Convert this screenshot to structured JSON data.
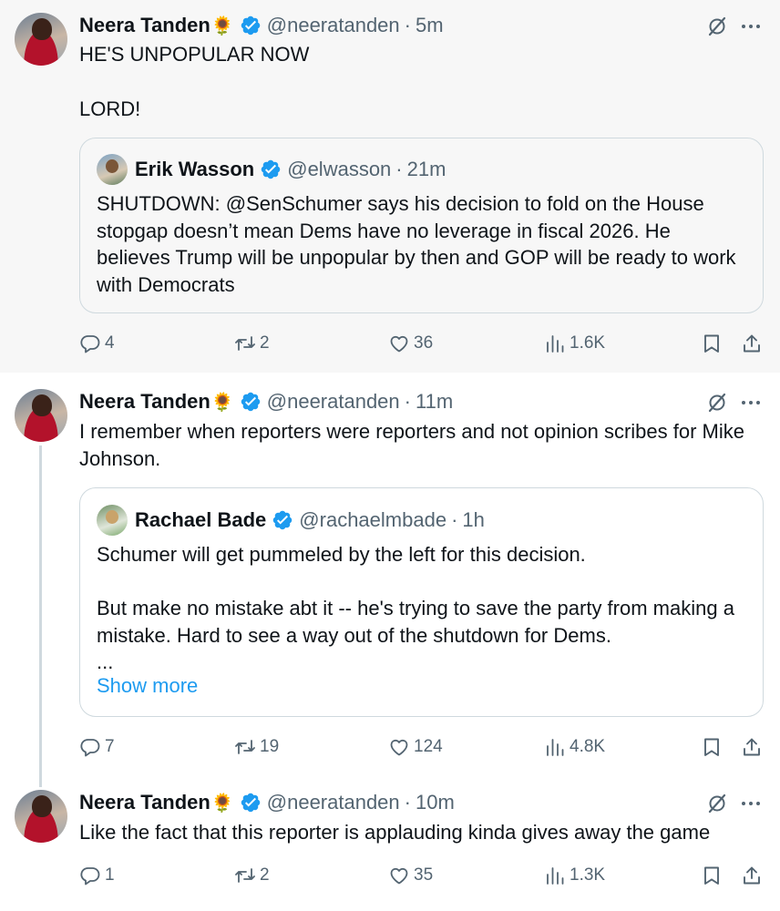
{
  "tweets": [
    {
      "author_name": "Neera Tanden",
      "emoji": "🌻",
      "handle": "@neeratanden",
      "dot": "·",
      "time": "5m",
      "text": "HE'S UNPOPULAR NOW\n\nLORD!",
      "quote": {
        "author_name": "Erik Wasson",
        "handle": "@elwasson",
        "dot": "·",
        "time": "21m",
        "text": "SHUTDOWN: @SenSchumer says his decision to fold on the House stopgap doesn’t mean Dems have no leverage in fiscal 2026. He believes Trump will be unpopular by then and GOP will be ready to work with Democrats"
      },
      "stats": {
        "replies": "4",
        "retweets": "2",
        "likes": "36",
        "views": "1.6K"
      }
    },
    {
      "author_name": "Neera Tanden",
      "emoji": "🌻",
      "handle": "@neeratanden",
      "dot": "·",
      "time": "11m",
      "text": "I remember when reporters were reporters and not opinion scribes for Mike Johnson.",
      "quote": {
        "author_name": "Rachael Bade",
        "handle": "@rachaelmbade",
        "dot": "·",
        "time": "1h",
        "text": "Schumer will get pummeled by the left for this decision.\n\nBut make no mistake abt it -- he's trying to save the party from making a mistake. Hard to see a way out of the shutdown for Dems.\n...",
        "show_more": "Show more"
      },
      "stats": {
        "replies": "7",
        "retweets": "19",
        "likes": "124",
        "views": "4.8K"
      }
    },
    {
      "author_name": "Neera Tanden",
      "emoji": "🌻",
      "handle": "@neeratanden",
      "dot": "·",
      "time": "10m",
      "text": "Like the fact that this reporter is applauding kinda gives away the game",
      "stats": {
        "replies": "1",
        "retweets": "2",
        "likes": "35",
        "views": "1.3K"
      }
    }
  ],
  "colors": {
    "accent": "#1d9bf0",
    "secondary_text": "#536471",
    "border": "#cfd9de"
  },
  "icons": [
    "verified-badge-icon",
    "grok-icon",
    "more-icon",
    "reply-icon",
    "retweet-icon",
    "like-icon",
    "views-icon",
    "bookmark-icon",
    "share-icon"
  ]
}
